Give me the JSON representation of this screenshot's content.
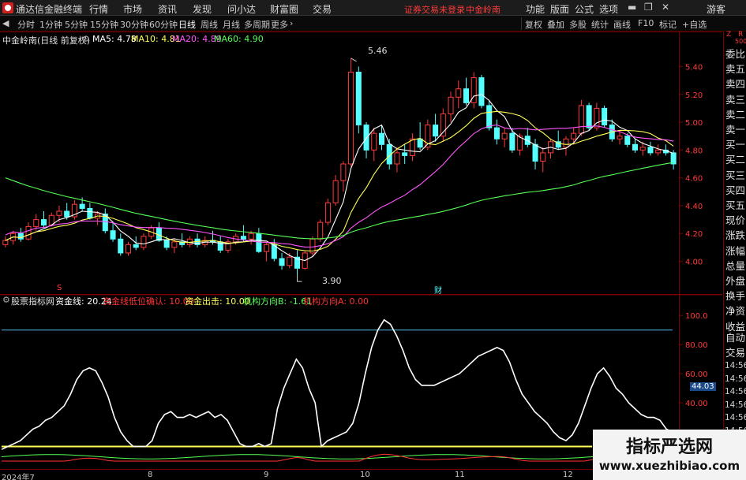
{
  "menubar": {
    "app_title": "通达信金融终端",
    "items": [
      "行情",
      "市场",
      "资讯",
      "发现",
      "问小达",
      "财富圈",
      "交易"
    ],
    "notice": "证券交易未登录",
    "stock_name_link": "中金岭南",
    "right_items": [
      "功能",
      "版面",
      "公式",
      "选项"
    ],
    "guest": "游客",
    "window_buttons": [
      "▬",
      "❐",
      "✕"
    ]
  },
  "periodbar": {
    "periods": [
      "分时",
      "1分钟",
      "5分钟",
      "15分钟",
      "30分钟",
      "60分钟",
      "日线",
      "周线",
      "月线",
      "多周期",
      "更多"
    ],
    "active_period": "日线",
    "more_arrow": "›",
    "tools": [
      "复权",
      "叠加",
      "多股",
      "统计",
      "画线",
      "F10",
      "标记",
      "+自选"
    ],
    "back_arrow": "◀"
  },
  "main_chart": {
    "title": "中金岭南(日线 前复权)",
    "ma_labels": [
      {
        "text": "MA5: 4.78",
        "color": "#ffffff"
      },
      {
        "text": "MA10: 4.81",
        "color": "#ffff55"
      },
      {
        "text": "MA20: 4.89",
        "color": "#ff55ff"
      },
      {
        "text": "MA60: 4.90",
        "color": "#55ff55"
      }
    ],
    "price_ticks": [
      "5.40",
      "5.20",
      "5.00",
      "4.80",
      "4.60",
      "4.40",
      "4.20",
      "4.00"
    ],
    "high_label": "5.46",
    "low_label": "3.90",
    "marker_s": "S",
    "marker_cai": "财"
  },
  "indicator": {
    "title": "股票指标网",
    "labels": [
      {
        "text": "资金线: 20.24",
        "color": "#ffffff"
      },
      {
        "text": "资金线低位确认: 10.00",
        "color": "#ff3333"
      },
      {
        "text": "资金出击: 10.00",
        "color": "#ffff55"
      },
      {
        "text": "机构方向B: -1.61",
        "color": "#55ff55"
      },
      {
        "text": "机构方向A: 0.00",
        "color": "#ff3333"
      }
    ],
    "ticks": [
      "100.0",
      "80.00",
      "60.00",
      "40.00",
      "20.00"
    ],
    "current_value": "44.03"
  },
  "chart_data": [
    {
      "type": "candlestick",
      "title": "中金岭南(日线 前复权)",
      "ylim": [
        3.85,
        5.55
      ],
      "yticks": [
        4.0,
        4.2,
        4.4,
        4.6,
        4.8,
        5.0,
        5.2,
        5.4
      ],
      "x_months": [
        "2024年7",
        "8",
        "9",
        "10",
        "11",
        "12"
      ],
      "candles": [
        [
          4.12,
          4.18,
          4.1,
          4.15
        ],
        [
          4.15,
          4.22,
          4.12,
          4.2
        ],
        [
          4.2,
          4.24,
          4.14,
          4.16
        ],
        [
          4.16,
          4.28,
          4.15,
          4.25
        ],
        [
          4.25,
          4.34,
          4.22,
          4.3
        ],
        [
          4.3,
          4.36,
          4.24,
          4.26
        ],
        [
          4.26,
          4.35,
          4.25,
          4.33
        ],
        [
          4.33,
          4.4,
          4.28,
          4.36
        ],
        [
          4.36,
          4.42,
          4.3,
          4.32
        ],
        [
          4.32,
          4.44,
          4.3,
          4.41
        ],
        [
          4.41,
          4.46,
          4.36,
          4.38
        ],
        [
          4.38,
          4.42,
          4.3,
          4.31
        ],
        [
          4.31,
          4.36,
          4.26,
          4.34
        ],
        [
          4.34,
          4.38,
          4.2,
          4.22
        ],
        [
          4.22,
          4.28,
          4.14,
          4.16
        ],
        [
          4.16,
          4.2,
          4.04,
          4.06
        ],
        [
          4.06,
          4.14,
          4.04,
          4.12
        ],
        [
          4.12,
          4.18,
          4.08,
          4.1
        ],
        [
          4.1,
          4.2,
          4.08,
          4.18
        ],
        [
          4.18,
          4.26,
          4.16,
          4.24
        ],
        [
          4.24,
          4.28,
          4.14,
          4.15
        ],
        [
          4.15,
          4.18,
          4.08,
          4.1
        ],
        [
          4.1,
          4.16,
          4.06,
          4.14
        ],
        [
          4.14,
          4.2,
          4.1,
          4.12
        ],
        [
          4.12,
          4.18,
          4.1,
          4.16
        ],
        [
          4.16,
          4.2,
          4.1,
          4.12
        ],
        [
          4.12,
          4.18,
          4.1,
          4.15
        ],
        [
          4.15,
          4.22,
          4.12,
          4.14
        ],
        [
          4.14,
          4.18,
          4.06,
          4.08
        ],
        [
          4.08,
          4.16,
          4.06,
          4.14
        ],
        [
          4.14,
          4.2,
          4.12,
          4.18
        ],
        [
          4.18,
          4.26,
          4.14,
          4.16
        ],
        [
          4.16,
          4.22,
          4.12,
          4.2
        ],
        [
          4.2,
          4.24,
          4.06,
          4.07
        ],
        [
          4.07,
          4.14,
          4.0,
          4.12
        ],
        [
          4.12,
          4.16,
          4.0,
          4.02
        ],
        [
          4.02,
          4.06,
          3.94,
          3.97
        ],
        [
          3.97,
          4.06,
          3.95,
          4.03
        ],
        [
          4.03,
          4.08,
          3.9,
          3.95
        ],
        [
          3.95,
          4.08,
          3.94,
          4.06
        ],
        [
          4.06,
          4.18,
          4.04,
          4.16
        ],
        [
          4.16,
          4.3,
          4.14,
          4.28
        ],
        [
          4.28,
          4.45,
          4.26,
          4.42
        ],
        [
          4.42,
          4.62,
          4.4,
          4.58
        ],
        [
          4.58,
          4.72,
          4.5,
          4.7
        ],
        [
          4.7,
          5.46,
          4.68,
          5.36
        ],
        [
          5.36,
          5.4,
          4.92,
          4.98
        ],
        [
          4.98,
          5.0,
          4.74,
          4.8
        ],
        [
          4.8,
          4.96,
          4.72,
          4.92
        ],
        [
          4.92,
          4.98,
          4.8,
          4.84
        ],
        [
          4.84,
          4.88,
          4.66,
          4.7
        ],
        [
          4.7,
          4.82,
          4.64,
          4.78
        ],
        [
          4.78,
          4.84,
          4.7,
          4.76
        ],
        [
          4.76,
          4.92,
          4.72,
          4.88
        ],
        [
          4.88,
          5.0,
          4.8,
          4.82
        ],
        [
          4.82,
          5.02,
          4.8,
          4.98
        ],
        [
          4.98,
          5.06,
          4.86,
          4.9
        ],
        [
          4.9,
          5.1,
          4.86,
          5.06
        ],
        [
          5.06,
          5.22,
          5.0,
          5.18
        ],
        [
          5.18,
          5.3,
          5.1,
          5.24
        ],
        [
          5.24,
          5.32,
          5.12,
          5.14
        ],
        [
          5.14,
          5.36,
          5.1,
          5.32
        ],
        [
          5.32,
          5.34,
          5.1,
          5.12
        ],
        [
          5.12,
          5.16,
          4.94,
          4.96
        ],
        [
          4.96,
          5.02,
          4.84,
          4.88
        ],
        [
          4.88,
          4.96,
          4.82,
          4.92
        ],
        [
          4.92,
          4.96,
          4.78,
          4.8
        ],
        [
          4.8,
          4.92,
          4.76,
          4.9
        ],
        [
          4.9,
          4.96,
          4.82,
          4.84
        ],
        [
          4.84,
          4.88,
          4.66,
          4.72
        ],
        [
          4.72,
          4.82,
          4.64,
          4.78
        ],
        [
          4.78,
          4.88,
          4.74,
          4.86
        ],
        [
          4.86,
          4.94,
          4.8,
          4.82
        ],
        [
          4.82,
          4.9,
          4.76,
          4.88
        ],
        [
          4.88,
          4.96,
          4.84,
          4.92
        ],
        [
          4.92,
          5.16,
          4.9,
          5.12
        ],
        [
          5.12,
          5.14,
          4.94,
          4.96
        ],
        [
          4.96,
          5.14,
          4.94,
          5.1
        ],
        [
          5.1,
          5.12,
          4.96,
          4.98
        ],
        [
          4.98,
          5.02,
          4.86,
          4.88
        ],
        [
          4.88,
          4.94,
          4.84,
          4.9
        ],
        [
          4.9,
          4.92,
          4.82,
          4.84
        ],
        [
          4.84,
          4.88,
          4.78,
          4.8
        ],
        [
          4.8,
          4.86,
          4.76,
          4.82
        ],
        [
          4.82,
          4.86,
          4.76,
          4.78
        ],
        [
          4.78,
          4.84,
          4.76,
          4.8
        ],
        [
          4.8,
          4.84,
          4.76,
          4.78
        ],
        [
          4.78,
          4.8,
          4.66,
          4.7
        ]
      ],
      "series": [
        {
          "name": "MA5",
          "last": 4.78
        },
        {
          "name": "MA10",
          "last": 4.81
        },
        {
          "name": "MA20",
          "last": 4.89
        },
        {
          "name": "MA60",
          "last": 4.9
        }
      ]
    },
    {
      "type": "line",
      "title": "股票指标网",
      "ylim": [
        0,
        105
      ],
      "yticks": [
        20,
        40,
        60,
        80,
        100
      ],
      "series": [
        {
          "name": "资金线",
          "values": [
            8,
            10,
            12,
            14,
            18,
            22,
            24,
            28,
            30,
            34,
            38,
            46,
            56,
            62,
            64,
            62,
            54,
            44,
            30,
            20,
            14,
            10,
            10,
            10,
            14,
            26,
            32,
            34,
            30,
            30,
            32,
            30,
            32,
            34,
            30,
            32,
            28,
            20,
            12,
            10,
            10,
            12,
            10,
            12,
            36,
            50,
            60,
            70,
            64,
            50,
            40,
            10,
            14,
            16,
            18,
            20,
            26,
            40,
            60,
            78,
            90,
            97,
            94,
            86,
            76,
            64,
            56,
            52,
            52,
            52,
            54,
            56,
            58,
            60,
            64,
            68,
            72,
            74,
            76,
            78,
            76,
            68,
            56,
            46,
            40,
            34,
            30,
            26,
            20,
            16,
            14,
            18,
            26,
            38,
            50,
            60,
            64,
            58,
            50,
            46,
            40,
            36,
            32,
            30,
            30,
            28,
            22,
            20
          ]
        },
        {
          "name": "资金线低位确认",
          "last": 10.0
        },
        {
          "name": "资金出击",
          "last": 10.0
        },
        {
          "name": "机构方向B",
          "last": -1.61
        },
        {
          "name": "机构方向A",
          "last": 0.0
        }
      ],
      "reference_lines": [
        {
          "value": 90,
          "color": "#4fb6e8"
        },
        {
          "value": 10,
          "color": "#ffff55"
        }
      ]
    }
  ],
  "right_panel": {
    "top_labels": [
      "Z",
      "R",
      "500"
    ],
    "items": [
      "委比",
      "卖五",
      "卖四",
      "卖三",
      "卖二",
      "卖一",
      "买一",
      "买二",
      "买三",
      "买四",
      "买五",
      "现价",
      "涨跌",
      "涨幅",
      "总量",
      "外盘",
      "换手",
      "净资",
      "收益",
      "自动",
      "交易"
    ],
    "times": [
      "14:56",
      "14:56",
      "14:56",
      "14:56",
      "14:56",
      "14:56",
      "14:56",
      "14:56",
      "14:56",
      "14:56"
    ]
  },
  "date_axis": {
    "labels": [
      "2024年7",
      "8",
      "9",
      "10",
      "11",
      "12"
    ]
  },
  "watermark": {
    "title": "指标严选网",
    "url": "www.xuezhibiao.com"
  },
  "colors": {
    "up": "#ff3b3b",
    "down": "#54ffff",
    "ma5": "#ffffff",
    "ma10": "#ffff55",
    "ma20": "#ff55ff",
    "ma60": "#55ff55",
    "grid_red": "#7a0000"
  }
}
